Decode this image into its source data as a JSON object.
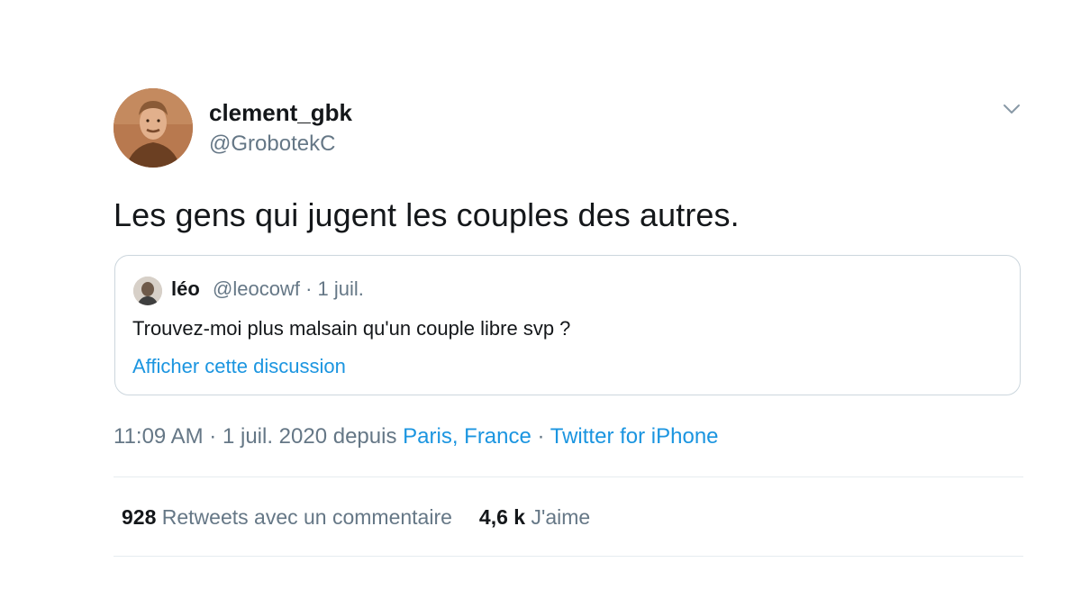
{
  "author": {
    "display_name": "clement_gbk",
    "handle": "@GrobotekC"
  },
  "tweet": {
    "text": "Les gens qui jugent les couples des autres."
  },
  "quoted_tweet": {
    "display_name": "léo",
    "handle": "@leocowf",
    "separator": "·",
    "date": "1 juil.",
    "text": "Trouvez-moi plus malsain qu'un couple libre svp ?",
    "show_thread_link": "Afficher cette discussion"
  },
  "meta": {
    "time": "11:09 AM",
    "separator": "·",
    "date": "1 juil. 2020",
    "from_word": "depuis",
    "location": "Paris, France",
    "source": "Twitter for iPhone"
  },
  "stats": {
    "retweets_count": "928",
    "retweets_label": "Retweets avec un commentaire",
    "likes_count": "4,6 k",
    "likes_label": "J'aime"
  },
  "icons": {
    "menu": "chevron-down-icon"
  },
  "colors": {
    "link": "#1b95e0",
    "secondary_text": "#657786",
    "primary_text": "#14171a",
    "border": "#ccd6dd"
  }
}
